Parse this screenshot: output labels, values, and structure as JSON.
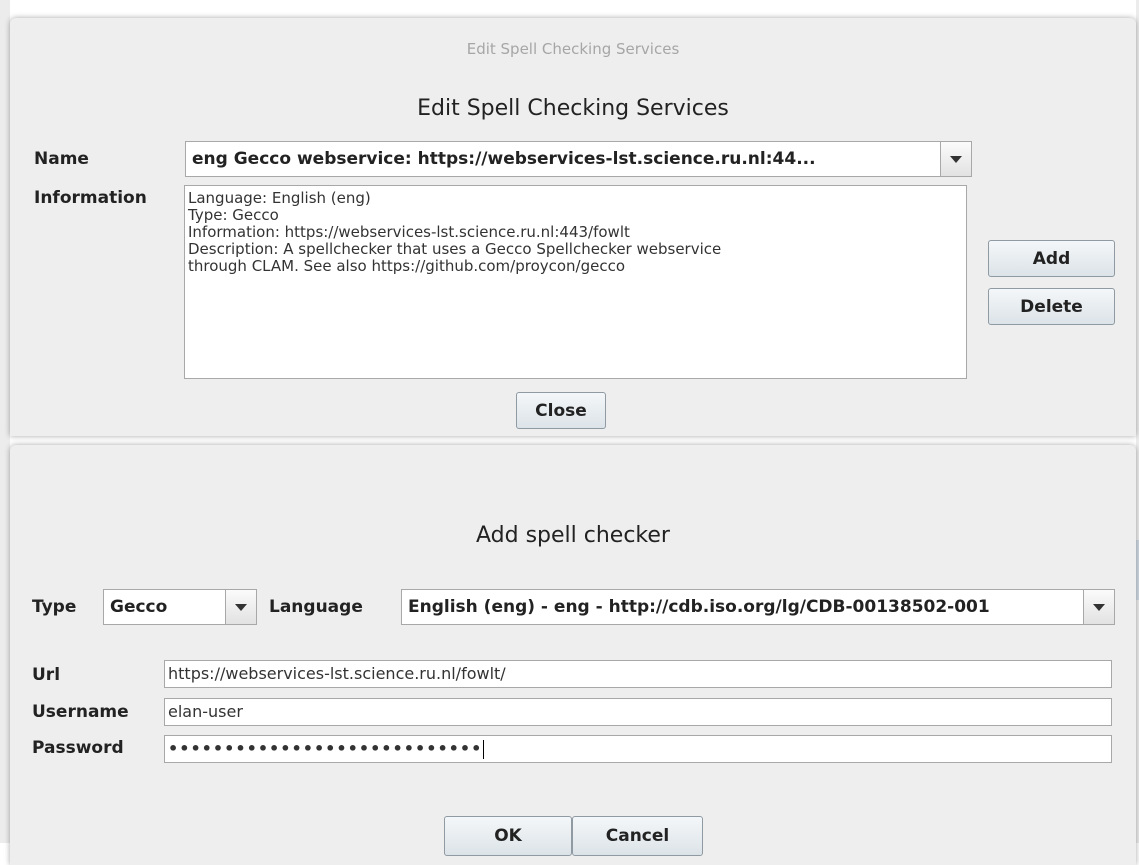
{
  "edit_dialog": {
    "window_title": "Edit Spell Checking Services",
    "heading": "Edit Spell Checking Services",
    "name_label": "Name",
    "name_value": "eng Gecco webservice: https://webservices-lst.science.ru.nl:44...",
    "information_label": "Information",
    "information_lines": [
      "Language: English (eng)",
      "Type: Gecco",
      "Information: https://webservices-lst.science.ru.nl:443/fowlt",
      "Description: A spellchecker that uses a Gecco Spellchecker webservice",
      "through CLAM. See also https://github.com/proycon/gecco"
    ],
    "add_label": "Add",
    "delete_label": "Delete",
    "close_label": "Close"
  },
  "add_dialog": {
    "heading": "Add spell checker",
    "type_label": "Type",
    "type_value": "Gecco",
    "language_label": "Language",
    "language_value": "English (eng) - eng - http://cdb.iso.org/lg/CDB-00138502-001",
    "url_label": "Url",
    "url_value": "https://webservices-lst.science.ru.nl/fowlt/",
    "username_label": "Username",
    "username_value": "elan-user",
    "password_label": "Password",
    "password_value": "••••••••••••••••••••••••••••",
    "ok_label": "OK",
    "cancel_label": "Cancel"
  },
  "icons": {
    "dropdown": "chevron-down-icon"
  }
}
